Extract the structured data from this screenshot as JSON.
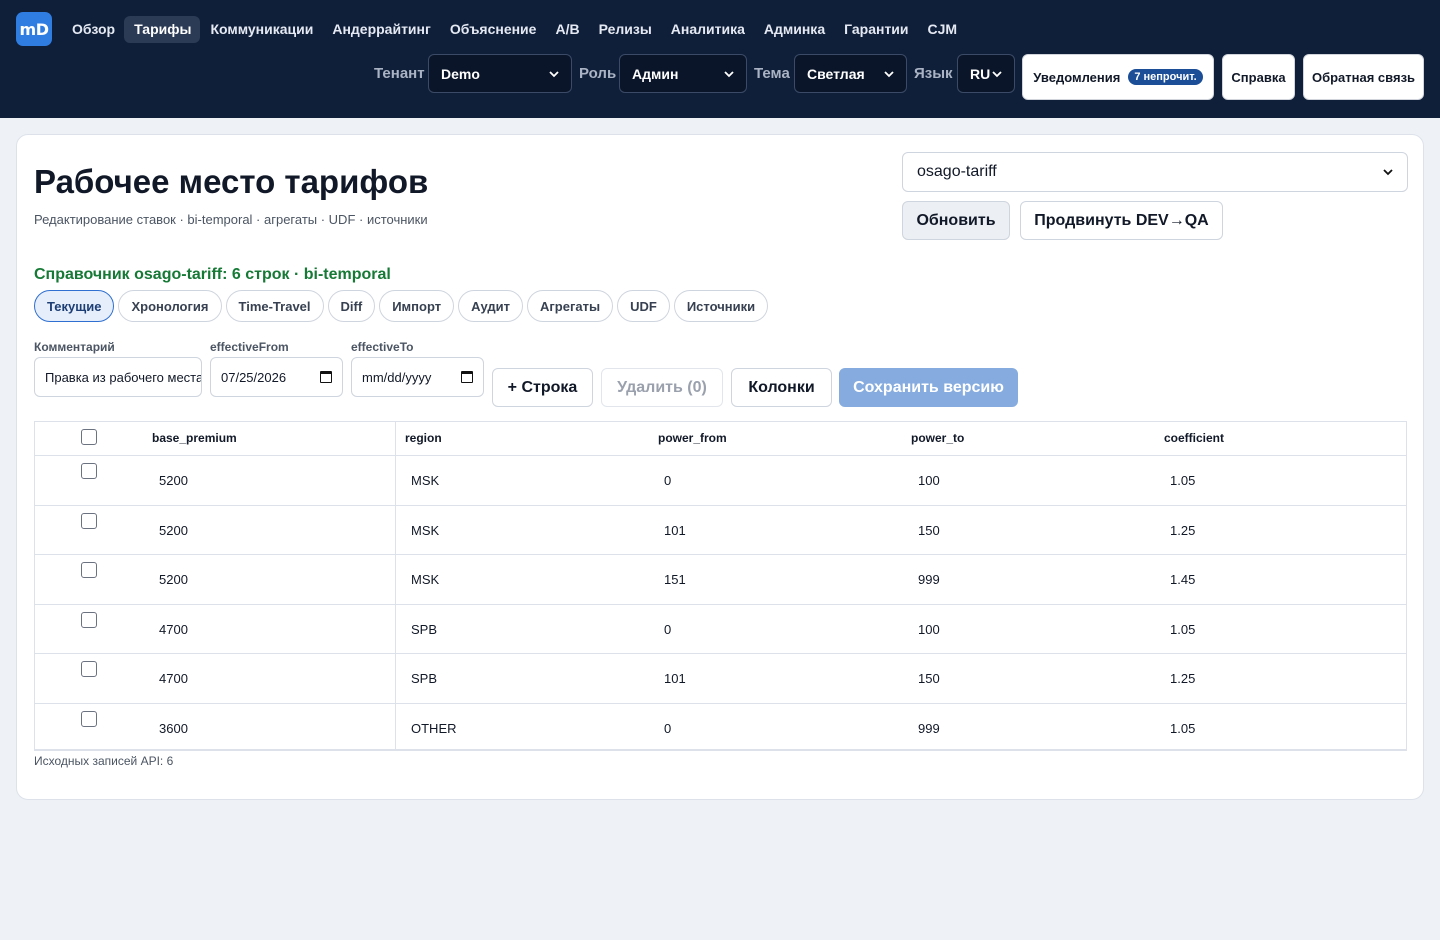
{
  "app": {
    "logo": "mD"
  },
  "nav": {
    "items": [
      "Обзор",
      "Тарифы",
      "Коммуникации",
      "Андеррайтинг",
      "Объяснение",
      "A/B",
      "Релизы",
      "Аналитика",
      "Админка",
      "Гарантии",
      "CJM"
    ],
    "active": "Тарифы"
  },
  "controls": {
    "tenant_label": "Тенант",
    "tenant_value": "Demo",
    "role_label": "Роль",
    "role_value": "Админ",
    "theme_label": "Тема",
    "theme_value": "Светлая",
    "lang_label": "Язык",
    "lang_value": "RU",
    "notifications_label": "Уведомления",
    "notifications_badge": "7 непрочит.",
    "help_label": "Справка",
    "feedback_label": "Обратная связь"
  },
  "page": {
    "title": "Рабочее место тарифов",
    "subtitle": "Редактирование ставок · bi-temporal · агрегаты · UDF · источники",
    "tariff_select": "osago-tariff",
    "refresh_label": "Обновить",
    "promote_label": "Продвинуть DEV→QA",
    "status": "Справочник osago-tariff: 6 строк · bi-temporal"
  },
  "tabs": [
    "Текущие",
    "Хронология",
    "Time-Travel",
    "Diff",
    "Импорт",
    "Аудит",
    "Агрегаты",
    "UDF",
    "Источники"
  ],
  "form": {
    "comment_label": "Комментарий",
    "comment_value": "Правка из рабочего места",
    "from_label": "effectiveFrom",
    "from_value": "07/25/2026",
    "to_label": "effectiveTo",
    "to_placeholder": "mm/dd/yyyy",
    "add_row_label": "+ Строка",
    "delete_label": "Удалить (0)",
    "columns_label": "Колонки",
    "save_label": "Сохранить версию"
  },
  "table": {
    "columns": [
      "base_premium",
      "region",
      "power_from",
      "power_to",
      "coefficient"
    ],
    "rows": [
      [
        "5200",
        "MSK",
        "0",
        "100",
        "1.05"
      ],
      [
        "5200",
        "MSK",
        "101",
        "150",
        "1.25"
      ],
      [
        "5200",
        "MSK",
        "151",
        "999",
        "1.45"
      ],
      [
        "4700",
        "SPB",
        "0",
        "100",
        "1.05"
      ],
      [
        "4700",
        "SPB",
        "101",
        "150",
        "1.25"
      ],
      [
        "3600",
        "OTHER",
        "0",
        "999",
        "1.05"
      ]
    ],
    "footnote": "Исходных записей API: 6"
  },
  "colors": {
    "header_bg": "#0f1f3a",
    "accent": "#2f7de1",
    "status_green": "#167a36",
    "primary_disabled": "#86acdf"
  }
}
